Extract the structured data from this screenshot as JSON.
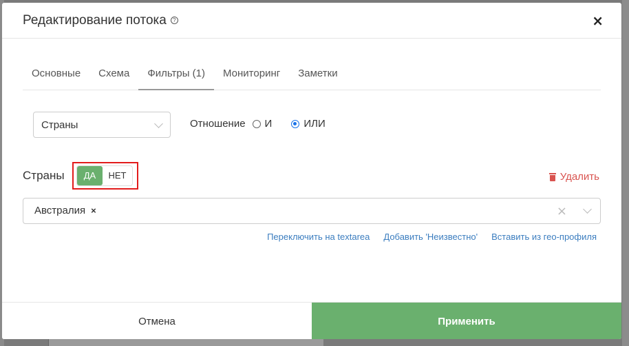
{
  "modal": {
    "title": "Редактирование потока",
    "close_label": "×"
  },
  "tabs": [
    {
      "label": "Основные"
    },
    {
      "label": "Схема"
    },
    {
      "label": "Фильтры (1)",
      "active": true
    },
    {
      "label": "Мониторинг"
    },
    {
      "label": "Заметки"
    }
  ],
  "filter_type_select": {
    "value": "Страны"
  },
  "relation": {
    "label": "Отношение",
    "options": [
      {
        "label": "И",
        "checked": false
      },
      {
        "label": "ИЛИ",
        "checked": true
      }
    ]
  },
  "filter": {
    "label": "Страны",
    "toggle_yes": "ДА",
    "toggle_no": "НЕТ",
    "toggle_selected": "yes",
    "delete_label": "Удалить",
    "tags": [
      {
        "label": "Австралия",
        "remove": "×"
      }
    ],
    "clear_label": "×"
  },
  "helper_links": [
    {
      "label": "Переключить на textarea"
    },
    {
      "label": "Добавить 'Неизвестно'"
    },
    {
      "label": "Вставить из гео-профиля"
    }
  ],
  "footer": {
    "cancel_label": "Отмена",
    "apply_label": "Применить"
  },
  "colors": {
    "accent_green": "#6ab06e",
    "link_blue": "#3b7dbf",
    "danger_red": "#d9534f",
    "highlight_red": "#e21b1b"
  }
}
